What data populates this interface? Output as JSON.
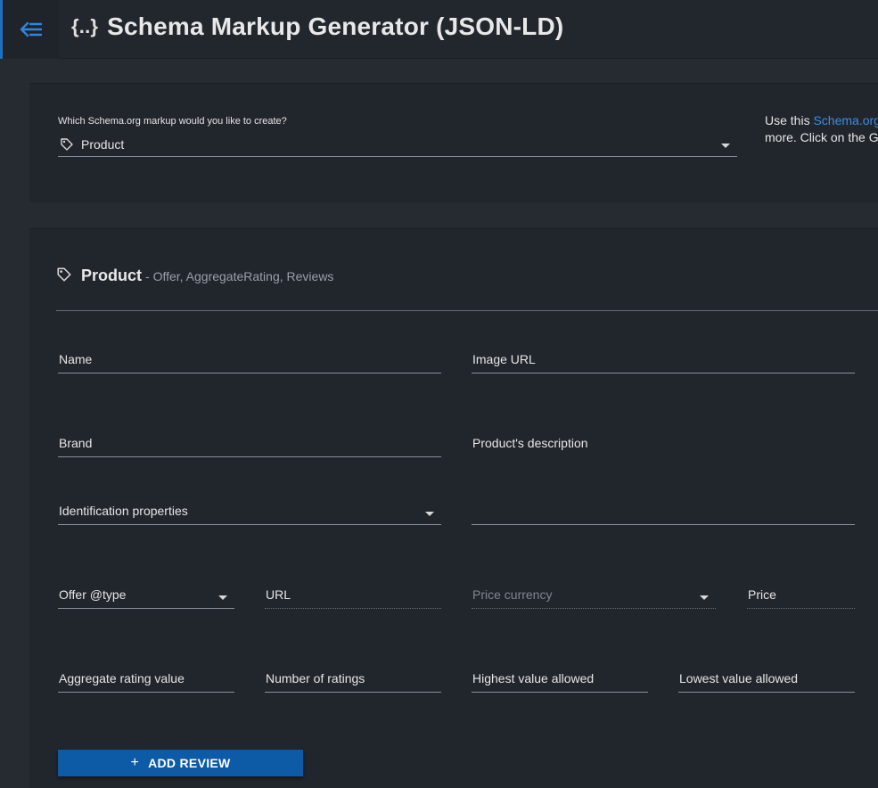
{
  "header": {
    "title": "Schema Markup Generator (JSON-LD)",
    "brace_glyph": "{..}",
    "accent_color": "#1f6fbf"
  },
  "selector": {
    "label": "Which Schema.org markup would you like to create?",
    "value": "Product",
    "info_prefix": "Use this ",
    "info_link": "Schema.org",
    "info_line2": "more. Click on the G"
  },
  "section": {
    "title": "Product",
    "subtitle": "- Offer, AggregateRating, Reviews"
  },
  "fields": {
    "name": "Name",
    "image_url": "Image URL",
    "brand": "Brand",
    "description": "Product's description",
    "identification": "Identification properties",
    "offer_type": "Offer @type",
    "url": "URL",
    "price_currency": "Price currency",
    "price": "Price",
    "rating_value": "Aggregate rating value",
    "rating_count": "Number of ratings",
    "best_rating": "Highest value allowed",
    "worst_rating": "Lowest value allowed"
  },
  "buttons": {
    "add_review_icon": "+",
    "add_review": "ADD REVIEW"
  }
}
